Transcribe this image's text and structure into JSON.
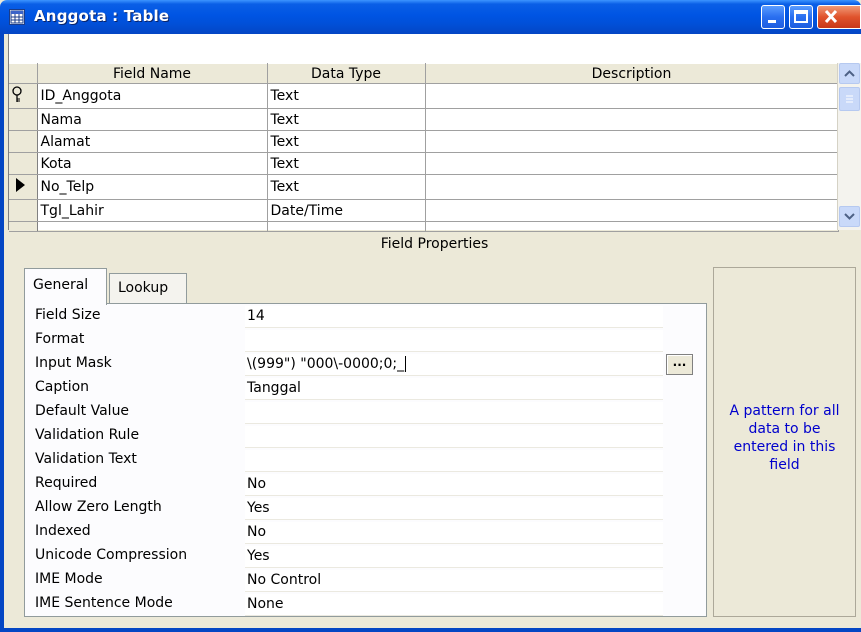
{
  "window": {
    "title": "Anggota : Table",
    "icon": "table-icon"
  },
  "grid": {
    "columns": [
      "Field Name",
      "Data Type",
      "Description"
    ],
    "rows": [
      {
        "field_name": "ID_Anggota",
        "data_type": "Text",
        "description": "",
        "indicator": "key-icon"
      },
      {
        "field_name": "Nama",
        "data_type": "Text",
        "description": "",
        "indicator": ""
      },
      {
        "field_name": "Alamat",
        "data_type": "Text",
        "description": "",
        "indicator": ""
      },
      {
        "field_name": "Kota",
        "data_type": "Text",
        "description": "",
        "indicator": ""
      },
      {
        "field_name": "No_Telp",
        "data_type": "Text",
        "description": "",
        "indicator": "current-row-arrow-icon"
      },
      {
        "field_name": "Tgl_Lahir",
        "data_type": "Date/Time",
        "description": "",
        "indicator": ""
      }
    ]
  },
  "field_properties": {
    "heading": "Field Properties",
    "tabs": [
      "General",
      "Lookup"
    ],
    "selected_tab": "General",
    "properties": [
      {
        "label": "Field Size",
        "value": "14"
      },
      {
        "label": "Format",
        "value": ""
      },
      {
        "label": "Input Mask",
        "value": "\\(999\") \"000\\-0000;0;_"
      },
      {
        "label": "Caption",
        "value": "Tanggal"
      },
      {
        "label": "Default Value",
        "value": ""
      },
      {
        "label": "Validation Rule",
        "value": ""
      },
      {
        "label": "Validation Text",
        "value": ""
      },
      {
        "label": "Required",
        "value": "No"
      },
      {
        "label": "Allow Zero Length",
        "value": "Yes"
      },
      {
        "label": "Indexed",
        "value": "No"
      },
      {
        "label": "Unicode Compression",
        "value": "Yes"
      },
      {
        "label": "IME Mode",
        "value": "No Control"
      },
      {
        "label": "IME Sentence Mode",
        "value": "None"
      }
    ],
    "builder_button": "...",
    "help_text": "A pattern for all data to be entered in this field"
  },
  "colors": {
    "titlebar": "#0054e3",
    "help_text": "#0000cc",
    "panel": "#ece9d8"
  }
}
